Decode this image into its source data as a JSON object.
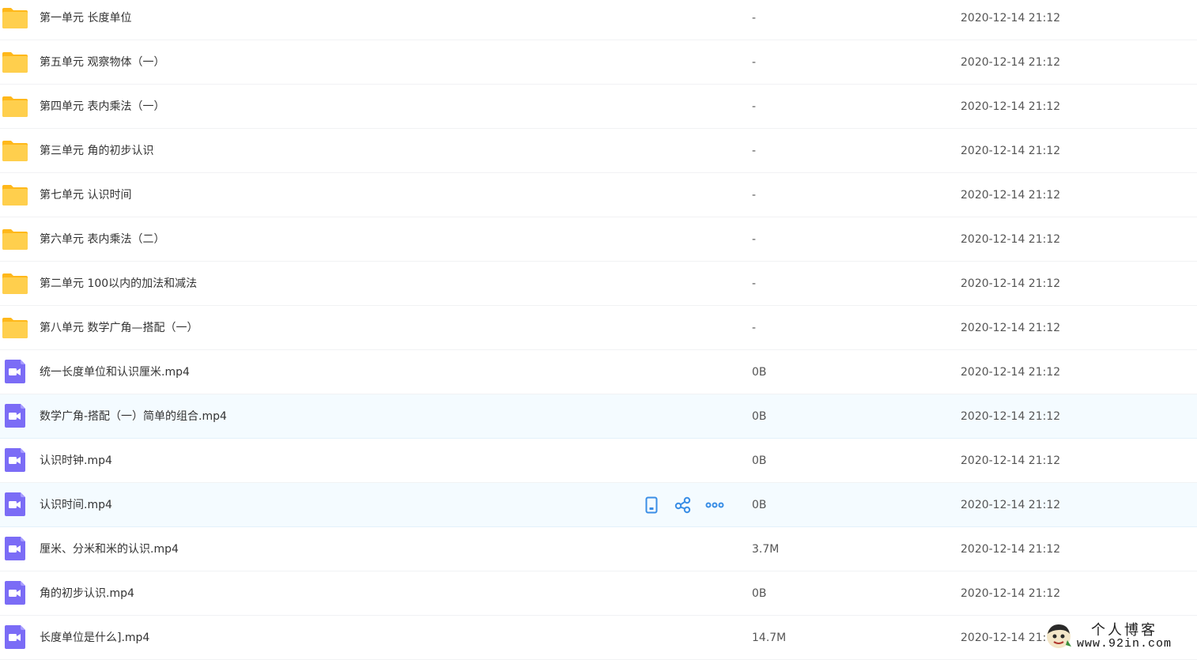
{
  "rows": [
    {
      "type": "folder",
      "name": "第一单元 长度单位",
      "size": "-",
      "date": "2020-12-14 21:12"
    },
    {
      "type": "folder",
      "name": "第五单元 观察物体（一）",
      "size": "-",
      "date": "2020-12-14 21:12"
    },
    {
      "type": "folder",
      "name": "第四单元 表内乘法（一）",
      "size": "-",
      "date": "2020-12-14 21:12"
    },
    {
      "type": "folder",
      "name": "第三单元 角的初步认识",
      "size": "-",
      "date": "2020-12-14 21:12"
    },
    {
      "type": "folder",
      "name": "第七单元 认识时间",
      "size": "-",
      "date": "2020-12-14 21:12"
    },
    {
      "type": "folder",
      "name": "第六单元 表内乘法（二）",
      "size": "-",
      "date": "2020-12-14 21:12"
    },
    {
      "type": "folder",
      "name": "第二单元 100以内的加法和减法",
      "size": "-",
      "date": "2020-12-14 21:12"
    },
    {
      "type": "folder",
      "name": "第八单元 数学广角—搭配（一）",
      "size": "-",
      "date": "2020-12-14 21:12"
    },
    {
      "type": "video",
      "name": "统一长度单位和认识厘米.mp4",
      "size": "0B",
      "date": "2020-12-14 21:12"
    },
    {
      "type": "video",
      "name": "数学广角-搭配（一）简单的组合.mp4",
      "size": "0B",
      "date": "2020-12-14 21:12"
    },
    {
      "type": "video",
      "name": "认识时钟.mp4",
      "size": "0B",
      "date": "2020-12-14 21:12"
    },
    {
      "type": "video",
      "name": "认识时间.mp4",
      "size": "0B",
      "date": "2020-12-14 21:12"
    },
    {
      "type": "video",
      "name": "厘米、分米和米的认识.mp4",
      "size": "3.7M",
      "date": "2020-12-14 21:12"
    },
    {
      "type": "video",
      "name": "角的初步认识.mp4",
      "size": "0B",
      "date": "2020-12-14 21:12"
    },
    {
      "type": "video",
      "name": "长度单位是什么].mp4",
      "size": "14.7M",
      "date": "2020-12-14 21:"
    }
  ],
  "icons": {
    "folder": "folder-icon",
    "video": "video-file-icon",
    "actions": [
      "phone-icon",
      "share-icon",
      "more-icon"
    ]
  },
  "colors": {
    "folder": "#ffc93c",
    "folder_tab": "#ffb81a",
    "video": "#7b6cf6",
    "accent": "#3a8ee6",
    "hover_bg": "#f4fbff"
  },
  "watermark": {
    "title": "个人博客",
    "url": "www.92in.com"
  }
}
